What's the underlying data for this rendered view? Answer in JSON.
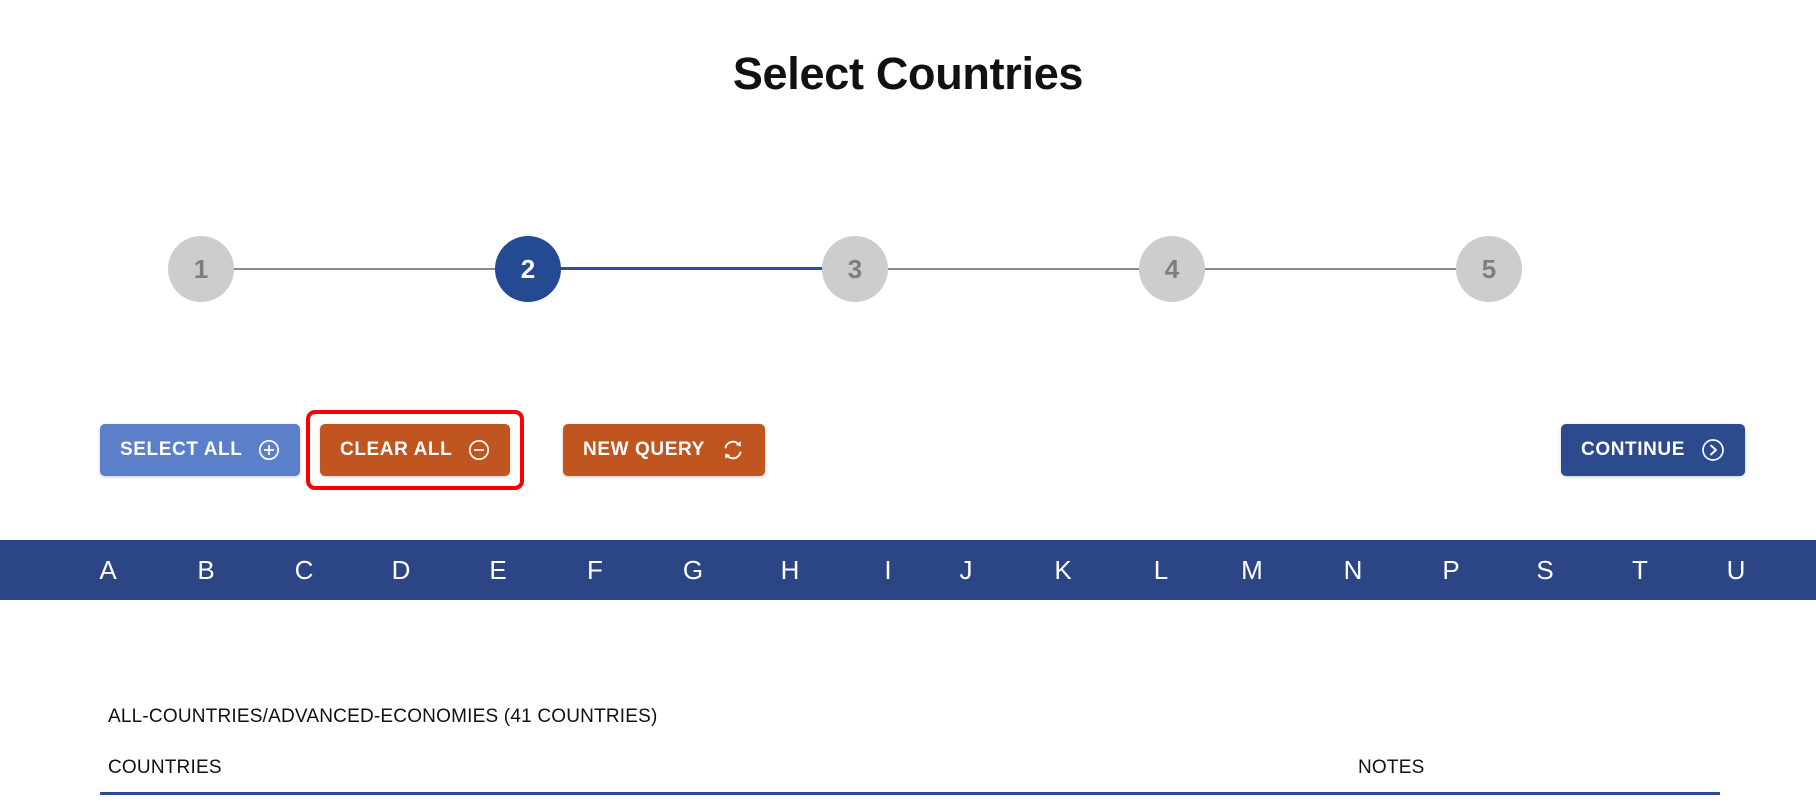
{
  "header": {
    "title": "Select Countries"
  },
  "stepper": {
    "current": 2,
    "steps": [
      {
        "label": "1",
        "state": "inactive"
      },
      {
        "label": "2",
        "state": "active"
      },
      {
        "label": "3",
        "state": "inactive"
      },
      {
        "label": "4",
        "state": "inactive"
      },
      {
        "label": "5",
        "state": "inactive"
      }
    ],
    "colors": {
      "active_fill": "#244a93",
      "inactive_fill": "#cdcdcd",
      "active_connector": "#2f4e9e",
      "inactive_connector": "#8a8a8a"
    }
  },
  "toolbar": {
    "select_all_label": "SELECT ALL",
    "select_all_icon": "plus-circle-icon",
    "clear_all_label": "CLEAR ALL",
    "clear_all_icon": "minus-circle-icon",
    "new_query_label": "NEW QUERY",
    "new_query_icon": "refresh-icon",
    "continue_label": "CONTINUE",
    "continue_icon": "chevron-right-circle-icon",
    "colors": {
      "select_all": "#5b7fc9",
      "clear_all": "#c1551f",
      "new_query": "#c1551f",
      "continue": "#2c4a8e",
      "highlight": "#fb0000"
    }
  },
  "alphabet_bar": {
    "background": "#2b4585",
    "letters": [
      "A",
      "B",
      "C",
      "D",
      "E",
      "F",
      "G",
      "H",
      "I",
      "J",
      "K",
      "L",
      "M",
      "N",
      "P",
      "S",
      "T",
      "U"
    ]
  },
  "results": {
    "group_label": "ALL-COUNTRIES/ADVANCED-ECONOMIES (41 COUNTRIES)",
    "columns": {
      "countries": "COUNTRIES",
      "notes": "NOTES"
    },
    "rule_color": "#2c4a8e"
  }
}
